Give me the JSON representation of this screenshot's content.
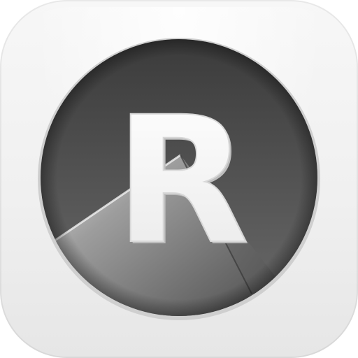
{
  "app_icon": {
    "letter": "R",
    "colors": {
      "tile_light": "#f4f4f4",
      "tile_edge": "#e3e3e3",
      "disc_dark": "#3a3a3a",
      "disc_mid": "#5a5a5a",
      "disc_rim": "#2a2a2a",
      "slice_light": "#bdbdbd",
      "slice_shadow": "#6f6f6f",
      "letter_face": "#f5f5f5",
      "letter_edge": "#cfcfcf"
    }
  }
}
